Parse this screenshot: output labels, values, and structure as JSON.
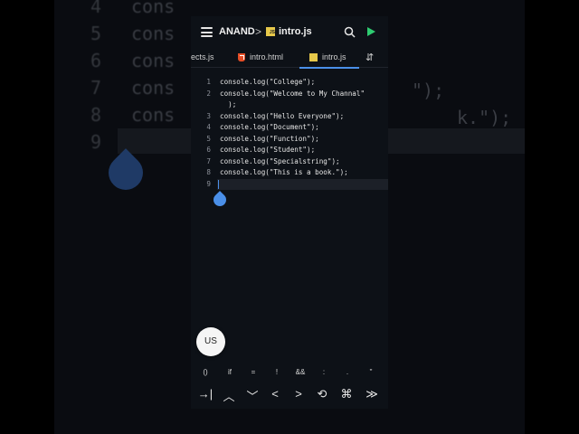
{
  "background": {
    "lines": [
      {
        "num": "4",
        "text": "cons"
      },
      {
        "num": "5",
        "text": "cons"
      },
      {
        "num": "6",
        "text": "cons"
      },
      {
        "num": "7",
        "text": "cons"
      },
      {
        "num": "8",
        "text": "cons"
      },
      {
        "num": "9",
        "text": ""
      }
    ],
    "tail_7": "\");",
    "tail_8": "k.\");"
  },
  "header": {
    "project": "ANAND",
    "separator": ">",
    "file": "intro.js",
    "js_badge": "JS"
  },
  "tabs": [
    {
      "label": "ects.js"
    },
    {
      "label": "intro.html"
    },
    {
      "label": "intro.js"
    }
  ],
  "sort_glyph": "⇵",
  "code": [
    {
      "num": "1",
      "text": "console.log(\"College\");"
    },
    {
      "num": "2",
      "text": "console.log(\"Welcome to My Channal\""
    },
    {
      "num": "",
      "text": "  );"
    },
    {
      "num": "3",
      "text": "console.log(\"Hello Everyone\");"
    },
    {
      "num": "4",
      "text": "console.log(\"Document\");"
    },
    {
      "num": "5",
      "text": "console.log(\"Function\");"
    },
    {
      "num": "6",
      "text": "console.log(\"Student\");"
    },
    {
      "num": "7",
      "text": "console.log(\"Specialstring\");"
    },
    {
      "num": "8",
      "text": "console.log(\"This is a book.\");"
    },
    {
      "num": "9",
      "text": ""
    }
  ],
  "keyboard_button": "US",
  "symbols": [
    "()",
    "if",
    "=",
    "!",
    "&&",
    ":",
    ".",
    "''"
  ],
  "nav_keys": [
    "→|",
    "︿",
    "﹀",
    "<",
    ">",
    "⟲",
    "⌘",
    "≫"
  ],
  "colors": {
    "accent": "#4a8fe8",
    "run": "#2ecc71",
    "js": "#e6c84a",
    "html": "#e44d26",
    "editor_bg": "#0d1117"
  }
}
